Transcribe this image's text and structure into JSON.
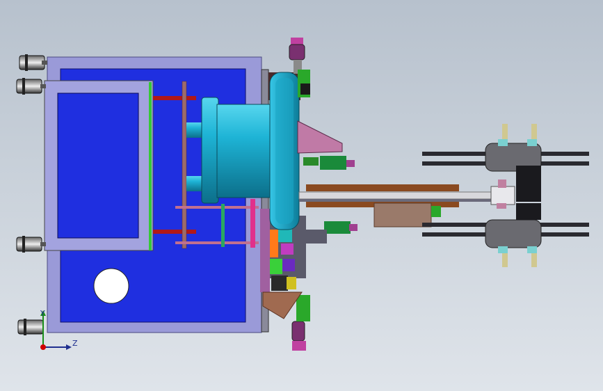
{
  "viewport": {
    "background_top": "#b7c1cd",
    "background_bottom": "#dfe4ea"
  },
  "triad": {
    "y_axis_label": "Y",
    "z_axis_label": "Z",
    "y_color": "#1a8f1a",
    "z_color": "#1f2f8f",
    "origin_color": "#d00000"
  },
  "model": {
    "frame_color": "#9a9ad8",
    "panel_color": "#1f2fe0",
    "rotor_color": "#1eb4d6",
    "rail_color": "#d8d8dc"
  }
}
